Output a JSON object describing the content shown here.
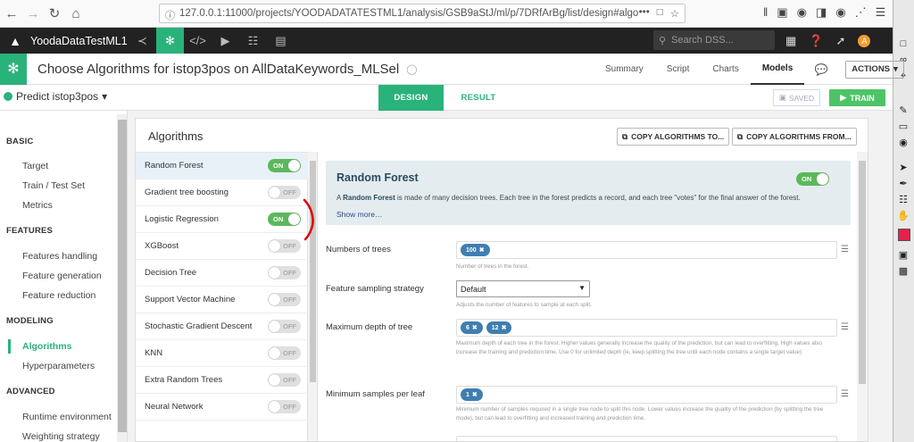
{
  "browser": {
    "url": "127.0.0.1:11000/projects/YOODADATATESTML1/analysis/GSB9aStJ/ml/p/7DRfArBg/list/design#algori",
    "url_ellipsis": "•••"
  },
  "topnav": {
    "project_name": "YoodaDataTestML1",
    "search_placeholder": "Search DSS...",
    "avatar_initial": "A"
  },
  "header": {
    "title": "Choose Algorithms for istop3pos on AllDataKeywords_MLSel",
    "tabs": [
      "Summary",
      "Script",
      "Charts",
      "Models"
    ],
    "active_tab": "Models",
    "actions_label": "ACTIONS"
  },
  "subheader": {
    "predict_label": "Predict istop3pos",
    "design_label": "DESIGN",
    "result_label": "RESULT",
    "saved_label": "SAVED",
    "train_label": "TRAIN"
  },
  "sidebar": {
    "sections": [
      {
        "title": "BASIC",
        "items": [
          "Target",
          "Train / Test Set",
          "Metrics"
        ]
      },
      {
        "title": "FEATURES",
        "items": [
          "Features handling",
          "Feature generation",
          "Feature reduction"
        ]
      },
      {
        "title": "MODELING",
        "items": [
          "Algorithms",
          "Hyperparameters"
        ]
      },
      {
        "title": "ADVANCED",
        "items": [
          "Runtime environment",
          "Weighting strategy"
        ]
      }
    ],
    "active_item": "Algorithms"
  },
  "main": {
    "title": "Algorithms",
    "copy_to_label": "COPY ALGORITHMS TO...",
    "copy_from_label": "COPY ALGORITHMS FROM...",
    "toggle_on": "ON",
    "toggle_off": "OFF",
    "algorithms": [
      {
        "name": "Random Forest",
        "enabled": true,
        "selected": true
      },
      {
        "name": "Gradient tree boosting",
        "enabled": false
      },
      {
        "name": "Logistic Regression",
        "enabled": true
      },
      {
        "name": "XGBoost",
        "enabled": false
      },
      {
        "name": "Decision Tree",
        "enabled": false
      },
      {
        "name": "Support Vector Machine",
        "enabled": false
      },
      {
        "name": "Stochastic Gradient Descent",
        "enabled": false
      },
      {
        "name": "KNN",
        "enabled": false
      },
      {
        "name": "Extra Random Trees",
        "enabled": false
      },
      {
        "name": "Neural Network",
        "enabled": false
      }
    ]
  },
  "detail": {
    "title": "Random Forest",
    "desc_prefix": "A ",
    "desc_bold": "Random Forest",
    "desc_rest": " is made of many decision trees. Each tree in the forest predicts a record, and each tree \"votes\" for the final answer of the forest.",
    "show_more": "Show more…",
    "params": {
      "n_trees": {
        "label": "Numbers of trees",
        "values": [
          "100"
        ],
        "help": "Number of trees in the forest."
      },
      "feature_sampling": {
        "label": "Feature sampling strategy",
        "value": "Default",
        "help": "Adjusts the number of features to sample at each split."
      },
      "max_depth": {
        "label": "Maximum depth of tree",
        "values": [
          "6",
          "12"
        ],
        "help": "Maximum depth of each tree in the forest. Higher values generally increase the quality of the prediction, but can lead to overfitting. High values also increase the training and prediction time. Use 0 for unlimited depth (ie, keep splitting the tree until each node contains a single target value)"
      },
      "min_samples": {
        "label": "Minimum samples per leaf",
        "values": [
          "1"
        ],
        "help": "Minimum number of samples required in a single tree node to split this node. Lower values increase the quality of the prediction (by splitting the tree mode), but can lead to overfitting and increased training and prediction time."
      }
    }
  },
  "colors": {
    "accent": "#2ab27b",
    "toggle_on": "#5cb85c",
    "tag": "#3f7eb0",
    "annotation": "#e00000"
  }
}
